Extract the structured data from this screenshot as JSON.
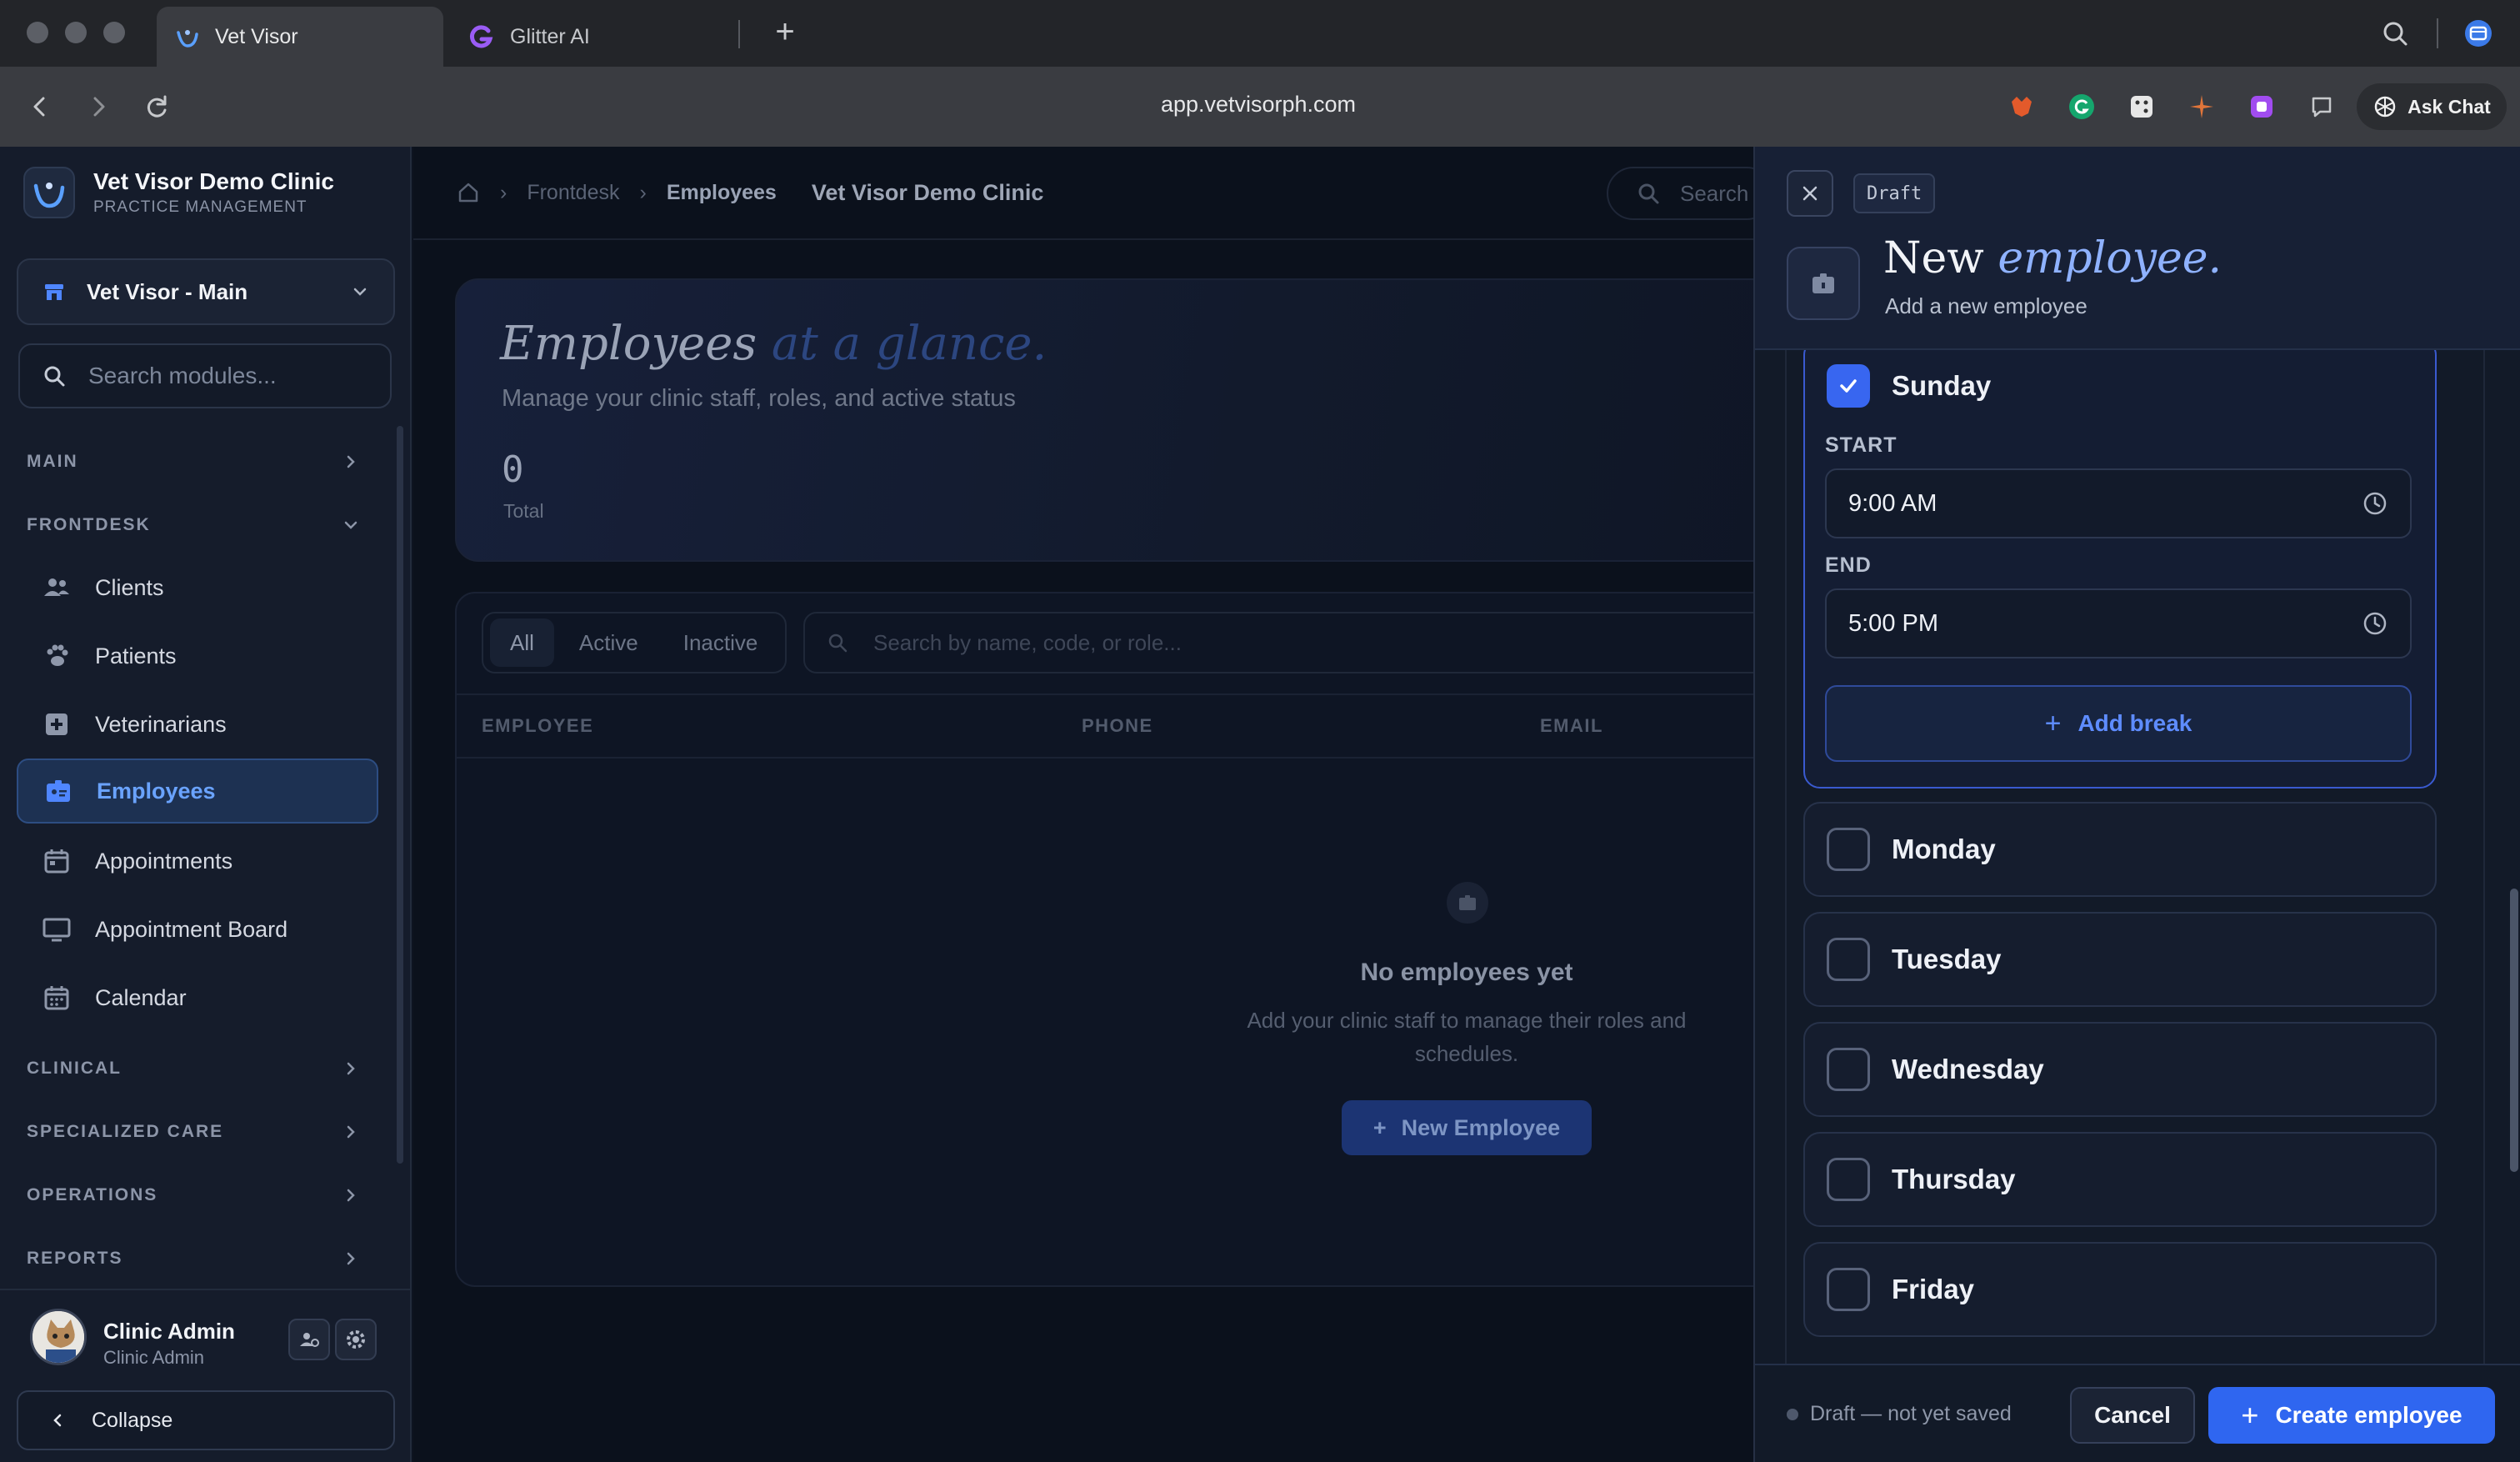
{
  "browser": {
    "tabs": [
      {
        "title": "Vet Visor",
        "active": true
      },
      {
        "title": "Glitter AI",
        "active": false
      }
    ],
    "url": "app.vetvisorph.com",
    "ask_chat": "Ask Chat"
  },
  "sidebar": {
    "brand": {
      "name": "Vet Visor Demo Clinic",
      "subtitle": "PRACTICE MANAGEMENT"
    },
    "branch": "Vet Visor - Main",
    "search_placeholder": "Search modules...",
    "sections": {
      "main": "MAIN",
      "frontdesk": "FRONTDESK",
      "clinical": "CLINICAL",
      "specialized_care": "SPECIALIZED CARE",
      "operations": "OPERATIONS",
      "reports": "REPORTS"
    },
    "items": [
      {
        "label": "Clients",
        "icon": "users-icon"
      },
      {
        "label": "Patients",
        "icon": "paw-icon"
      },
      {
        "label": "Veterinarians",
        "icon": "medical-plus-icon"
      },
      {
        "label": "Employees",
        "icon": "badge-icon",
        "active": true
      },
      {
        "label": "Appointments",
        "icon": "calendar-icon"
      },
      {
        "label": "Appointment Board",
        "icon": "monitor-icon"
      },
      {
        "label": "Calendar",
        "icon": "calendar-grid-icon"
      }
    ],
    "user": {
      "name": "Clinic Admin",
      "role": "Clinic Admin"
    },
    "collapse_label": "Collapse"
  },
  "main": {
    "breadcrumb": [
      "Frontdesk",
      "Employees"
    ],
    "clinic_name": "Vet Visor Demo Clinic",
    "search_placeholder": "Search",
    "hero": {
      "title_main": "Employees",
      "title_accent": "at a glance.",
      "subtitle": "Manage your clinic staff, roles, and active status",
      "count": "0",
      "count_label": "Total"
    },
    "filters": [
      "All",
      "Active",
      "Inactive"
    ],
    "table_search_placeholder": "Search by name, code, or role...",
    "columns": [
      "EMPLOYEE",
      "PHONE",
      "EMAIL"
    ],
    "empty": {
      "title": "No employees yet",
      "subtitle": "Add your clinic staff to manage their roles and schedules.",
      "button": "New Employee"
    }
  },
  "drawer": {
    "badge": "Draft",
    "title_main": "New",
    "title_accent": "employee.",
    "subtitle": "Add a new employee",
    "schedule": {
      "sunday": {
        "label": "Sunday",
        "checked": true,
        "start_label": "START",
        "start": "9:00 AM",
        "end_label": "END",
        "end": "5:00 PM",
        "add_break": "Add break"
      },
      "days": [
        {
          "label": "Monday",
          "checked": false
        },
        {
          "label": "Tuesday",
          "checked": false
        },
        {
          "label": "Wednesday",
          "checked": false
        },
        {
          "label": "Thursday",
          "checked": false
        },
        {
          "label": "Friday",
          "checked": false
        }
      ]
    },
    "footer": {
      "status": "Draft — not yet saved",
      "cancel": "Cancel",
      "create": "Create employee"
    }
  },
  "colors": {
    "accent": "#2f66f0",
    "sidebar_bg": "#151c2b",
    "active_nav": "#6aa3ff"
  }
}
